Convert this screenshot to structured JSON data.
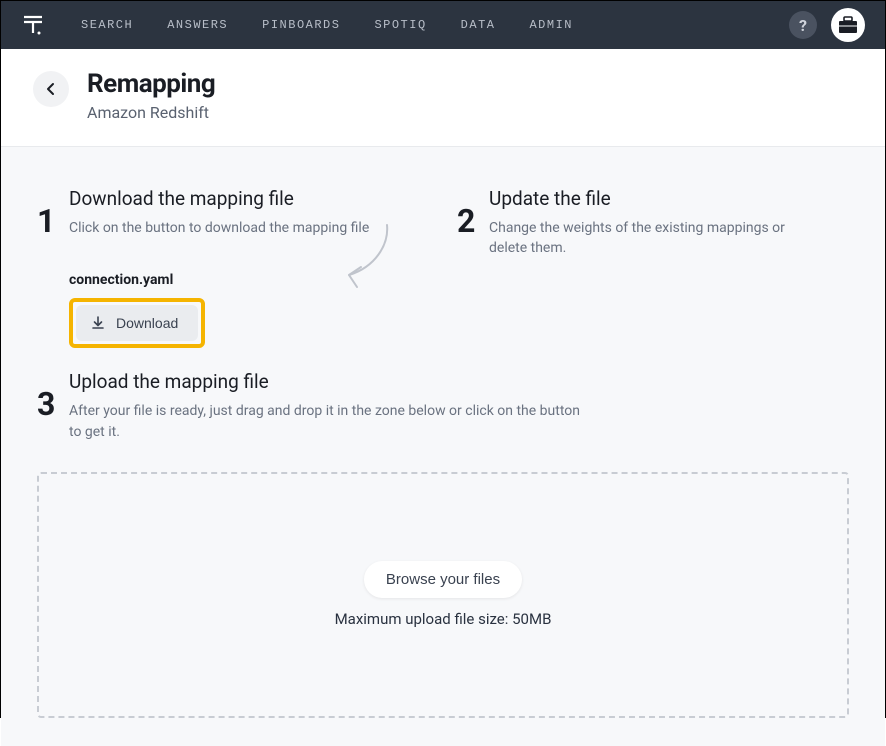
{
  "nav": {
    "items": [
      "SEARCH",
      "ANSWERS",
      "PINBOARDS",
      "SPOTIQ",
      "DATA",
      "ADMIN"
    ]
  },
  "header": {
    "title": "Remapping",
    "subtitle": "Amazon Redshift"
  },
  "steps": {
    "1": {
      "number": "1",
      "title": "Download the mapping file",
      "desc": "Click on the button to download the mapping file"
    },
    "2": {
      "number": "2",
      "title": "Update the file",
      "desc": "Change the weights of the existing mappings or delete them."
    },
    "3": {
      "number": "3",
      "title": "Upload the mapping file",
      "desc": "After your file is ready, just drag and drop it in the zone below or click on the button to get it."
    }
  },
  "download": {
    "filename": "connection.yaml",
    "button_label": "Download"
  },
  "upload": {
    "browse_label": "Browse your files",
    "max_size_text": "Maximum upload file size: 50MB"
  },
  "help_glyph": "?"
}
